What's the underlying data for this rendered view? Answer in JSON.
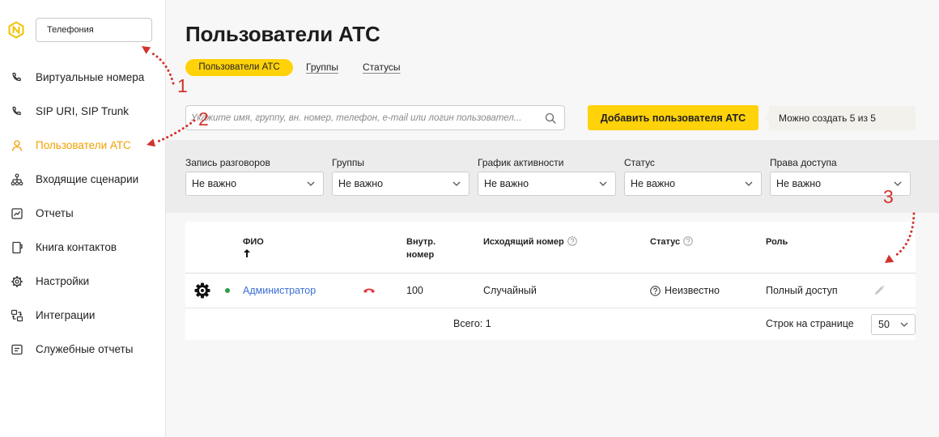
{
  "app": {
    "logo_icon": "brand-logo-icon",
    "section_select": {
      "value": "Телефония"
    }
  },
  "sidebar": {
    "items": [
      {
        "label": "Виртуальные номера",
        "icon": "phone-forward-icon"
      },
      {
        "label": "SIP URI, SIP Trunk",
        "icon": "phone-forward-icon"
      },
      {
        "label": "Пользователи АТС",
        "icon": "user-icon",
        "active": true
      },
      {
        "label": "Входящие сценарии",
        "icon": "sitemap-icon"
      },
      {
        "label": "Отчеты",
        "icon": "report-icon"
      },
      {
        "label": "Книга контактов",
        "icon": "book-icon"
      },
      {
        "label": "Настройки",
        "icon": "settings-icon"
      },
      {
        "label": "Интеграции",
        "icon": "integrations-icon"
      },
      {
        "label": "Служебные отчеты",
        "icon": "document-icon"
      }
    ]
  },
  "page": {
    "title": "Пользователи АТС",
    "tabs": [
      {
        "label": "Пользователи АТС",
        "active": true
      },
      {
        "label": "Группы"
      },
      {
        "label": "Статусы"
      }
    ]
  },
  "search": {
    "placeholder": "Укажите имя, группу, вн. номер, телефон, e-mail или логин пользовател...",
    "icon": "search-icon"
  },
  "toolbar": {
    "add_button": "Добавить пользователя АТС",
    "quota": "Можно создать 5 из 5"
  },
  "filters": [
    {
      "label": "Запись разговоров",
      "value": "Не важно"
    },
    {
      "label": "Группы",
      "value": "Не важно"
    },
    {
      "label": "График активности",
      "value": "Не важно"
    },
    {
      "label": "Статус",
      "value": "Не важно"
    },
    {
      "label": "Права доступа",
      "value": "Не важно"
    }
  ],
  "table": {
    "columns": [
      {
        "label": "ФИО",
        "sort_icon": "arrow-up-icon"
      },
      {
        "label": "Внутр. номер"
      },
      {
        "label": "Исходящий номер",
        "help_icon": "question-circle-icon"
      },
      {
        "label": "Статус",
        "help_icon": "question-circle-icon"
      },
      {
        "label": "Роль"
      }
    ],
    "rows": [
      {
        "settings_icon": "gear-icon",
        "online": true,
        "name": "Администратор",
        "call_icon": "hangup-icon",
        "ext": "100",
        "outgoing": "Случайный",
        "status_icon": "question-circle-icon",
        "status": "Неизвестно",
        "role": "Полный доступ",
        "edit_icon": "pencil-icon"
      }
    ],
    "footer": {
      "total": "Всего: 1",
      "rows_per_page_label": "Строк на странице",
      "rows_per_page": "50"
    }
  },
  "annotations": [
    {
      "label": "1"
    },
    {
      "label": "2"
    },
    {
      "label": "3"
    }
  ],
  "colors": {
    "accent": "#ffd20a",
    "active": "#f0a000",
    "link": "#3b6fd4",
    "danger": "#e0393e",
    "online": "#2f9e44",
    "annotation": "#d2322d"
  }
}
